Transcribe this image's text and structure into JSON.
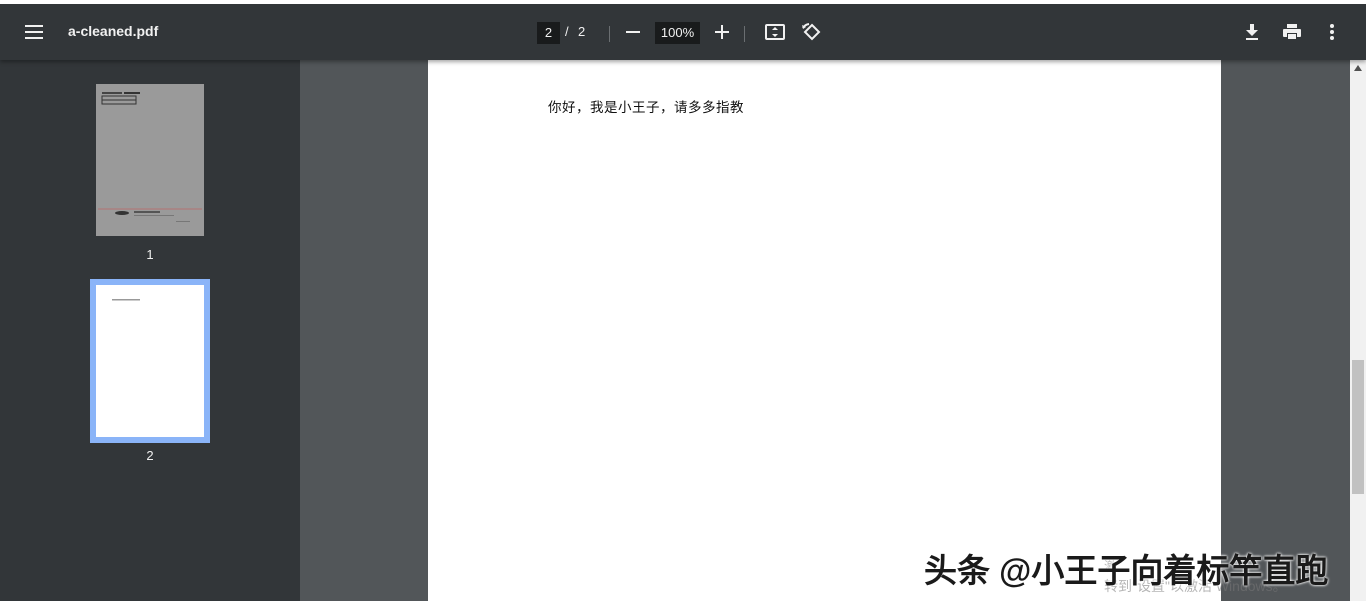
{
  "toolbar": {
    "menu_icon": "hamburger-menu-icon",
    "title": "a-cleaned.pdf",
    "page_current": "2",
    "page_separator": "/",
    "page_total": "2",
    "zoom_out_icon": "minus-icon",
    "zoom_value": "100%",
    "zoom_in_icon": "plus-icon",
    "fit_icon": "fit-to-page-icon",
    "rotate_icon": "rotate-counterclockwise-icon",
    "download_icon": "download-icon",
    "print_icon": "print-icon",
    "more_icon": "more-vert-icon"
  },
  "sidebar": {
    "thumbnails": [
      {
        "label": "1",
        "selected": false
      },
      {
        "label": "2",
        "selected": true
      }
    ]
  },
  "document": {
    "page_text": "你好，我是小王子，请多多指教"
  },
  "overlay": {
    "watermark": "头条 @小王子向着标竿直跑",
    "windows_line1": "激",
    "windows_line2": "转到\"设置\"以激活 Windows。"
  },
  "colors": {
    "toolbar_bg": "#323639",
    "viewer_bg": "#525659",
    "selected_thumb_border": "#8ab4f8"
  }
}
